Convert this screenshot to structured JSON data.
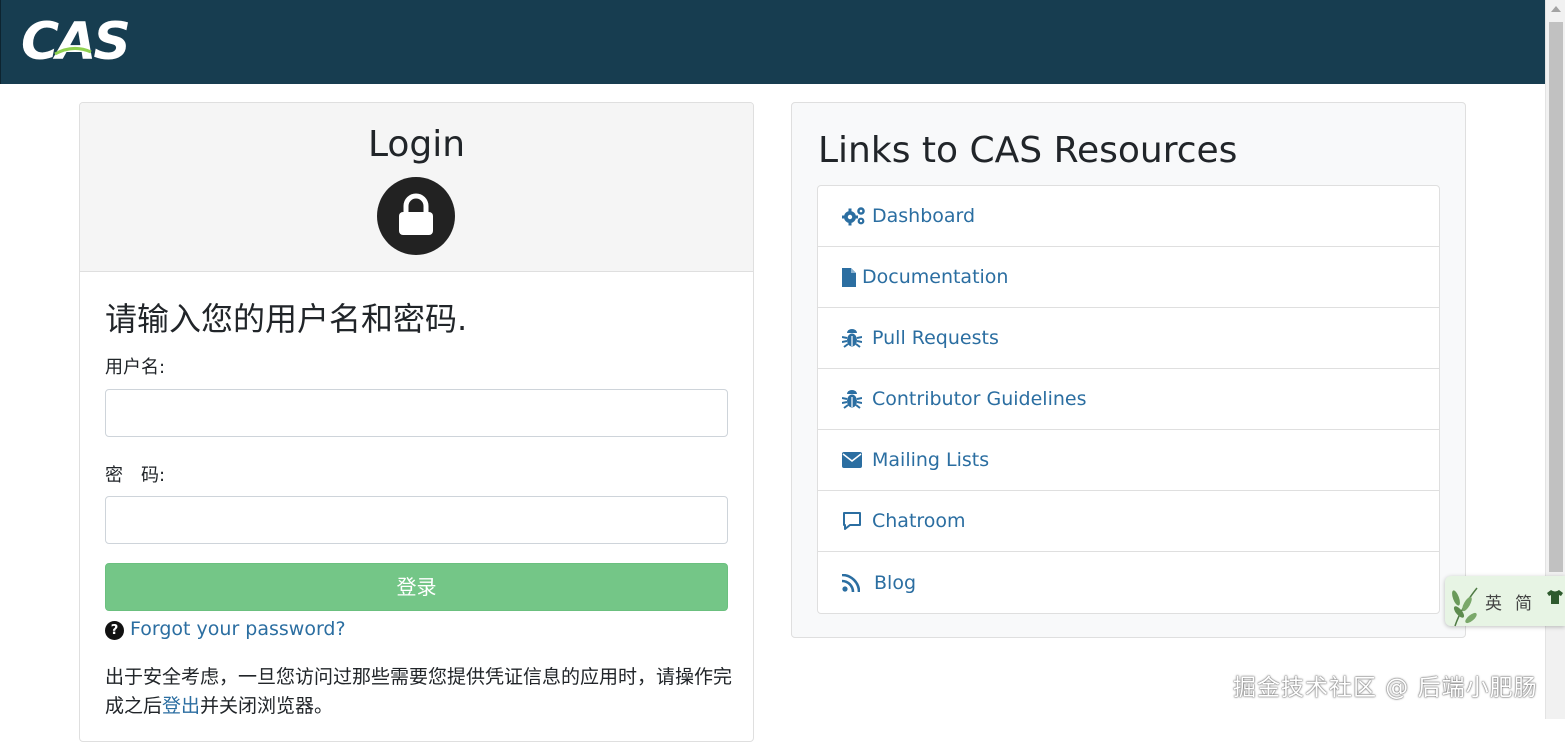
{
  "header": {
    "logo_text": "CAS",
    "brand_color": "#173d50"
  },
  "login": {
    "title": "Login",
    "prompt": "请输入您的用户名和密码.",
    "username_label": "用户名:",
    "password_label": "密　码:",
    "username_value": "",
    "password_value": "",
    "submit_label": "登录",
    "submit_color": "#74c687",
    "forgot_label": "Forgot your password?",
    "notice_before": "出于安全考虑，一旦您访问过那些需要您提供凭证信息的应用时，请操作完成之后",
    "notice_link": "登出",
    "notice_after": "并关闭浏览器。"
  },
  "resources": {
    "title": "Links to CAS Resources",
    "items": [
      {
        "label": "Dashboard",
        "icon": "cogs-icon"
      },
      {
        "label": "Documentation",
        "icon": "file-icon"
      },
      {
        "label": "Pull Requests",
        "icon": "bug-icon"
      },
      {
        "label": "Contributor Guidelines",
        "icon": "bug-icon"
      },
      {
        "label": "Mailing Lists",
        "icon": "envelope-icon"
      },
      {
        "label": "Chatroom",
        "icon": "comment-icon"
      },
      {
        "label": "Blog",
        "icon": "rss-icon"
      }
    ],
    "link_color": "#2b6ea1"
  },
  "translate_widget": {
    "option_en": "英",
    "option_zh": "简"
  },
  "watermark": "掘金技术社区 @ 后端小肥肠"
}
